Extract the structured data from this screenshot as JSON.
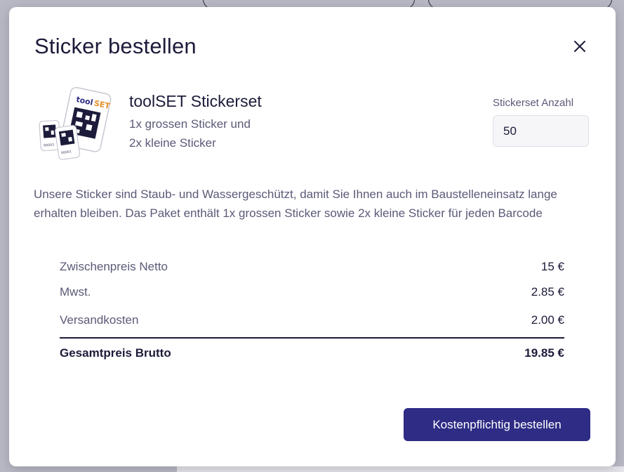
{
  "modal": {
    "title": "Sticker bestellen",
    "close_icon": "close-icon"
  },
  "product": {
    "image_icon": "sticker-set-image",
    "name": "toolSET Stickerset",
    "desc_line1": "1x grossen Sticker und",
    "desc_line2": "2x kleine Sticker"
  },
  "quantity": {
    "label": "Stickerset Anzahl",
    "value": "50"
  },
  "info_text": "Unsere Sticker sind Staub- und Wassergeschützt, damit Sie Ihnen auch im Baustelleneinsatz lange erhalten bleiben. Das Paket enthält 1x grossen Sticker sowie 2x kleine Sticker für jeden Barcode",
  "prices": {
    "subtotal_label": "Zwischenpreis Netto",
    "subtotal_value": "15 €",
    "vat_label": "Mwst.",
    "vat_value": "2.85 €",
    "shipping_label": "Versandkosten",
    "shipping_value": "2.00 €",
    "total_label": "Gesamtpreis Brutto",
    "total_value": "19.85 €"
  },
  "actions": {
    "order_label": "Kostenpflichtig bestellen"
  },
  "colors": {
    "primary": "#2e2c85",
    "text_dark": "#1c1b3a",
    "text_muted": "#5b5a78",
    "overlay": "#b9b9c6"
  }
}
